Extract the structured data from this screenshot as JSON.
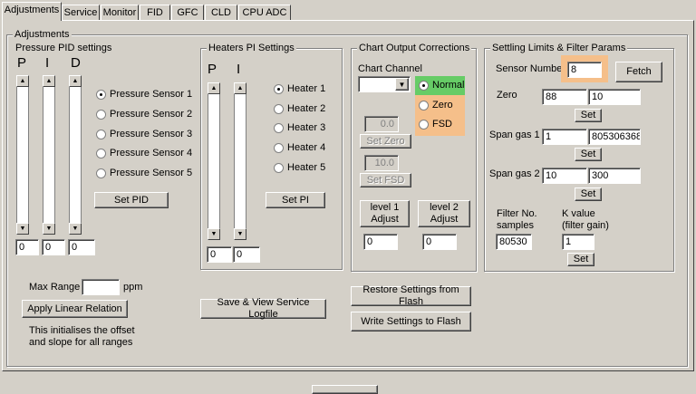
{
  "tabs": [
    "Adjustments",
    "Service",
    "Monitor",
    "FID",
    "GFC",
    "CLD",
    "CPU ADC"
  ],
  "adjustments_title": "Adjustments",
  "pid": {
    "title": "Pressure PID settings",
    "letters": [
      "P",
      "I",
      "D"
    ],
    "values": [
      "0",
      "0",
      "0"
    ],
    "sensors": [
      "Pressure Sensor 1",
      "Pressure Sensor 2",
      "Pressure Sensor 3",
      "Pressure Sensor 4",
      "Pressure Sensor 5"
    ],
    "selected": 0,
    "set_label": "Set PID"
  },
  "heaters": {
    "title": "Heaters PI Settings",
    "letters": [
      "P",
      "I"
    ],
    "values": [
      "0",
      "0"
    ],
    "items": [
      "Heater 1",
      "Heater 2",
      "Heater 3",
      "Heater 4",
      "Heater 5"
    ],
    "selected": 0,
    "set_label": "Set PI"
  },
  "chart": {
    "title": "Chart Output Corrections",
    "channel_label": "Chart Channel",
    "modes": [
      "Normal",
      "Zero",
      "FSD"
    ],
    "selected": 0,
    "colors": {
      "normal": "#66cc66",
      "zero_fsd": "#f5bf8a"
    },
    "zero_value": "0.0",
    "set_zero": "Set Zero",
    "fsd_value": "10.0",
    "set_fsd": "Set FSD",
    "level1": "level 1 Adjust",
    "level2": "level 2 Adjust",
    "level1_value": "0",
    "level2_value": "0"
  },
  "settling": {
    "title": "Settling Limits & Filter Params",
    "sensor_number_label": "Sensor Number",
    "sensor_number": "8",
    "fetch_label": "Fetch",
    "zero_label": "Zero",
    "zero_a": "88",
    "zero_b": "10",
    "span1_label": "Span gas 1",
    "span1_a": "1",
    "span1_b": "805306368",
    "span2_label": "Span gas 2",
    "span2_a": "10",
    "span2_b": "300",
    "set_label": "Set",
    "filter_label": "Filter No. samples",
    "filter_value": "80530",
    "k_label": "K value (filter gain)",
    "k_value": "1"
  },
  "max_range_label": "Max Range",
  "max_range_unit": "ppm",
  "max_range_value": "",
  "apply_linear": "Apply Linear Relation",
  "apply_note": "This initialises the offset and slope for all ranges",
  "save_logfile": "Save & View Service Logfile",
  "restore_flash": "Restore Settings from Flash",
  "write_flash": "Write Settings to Flash"
}
